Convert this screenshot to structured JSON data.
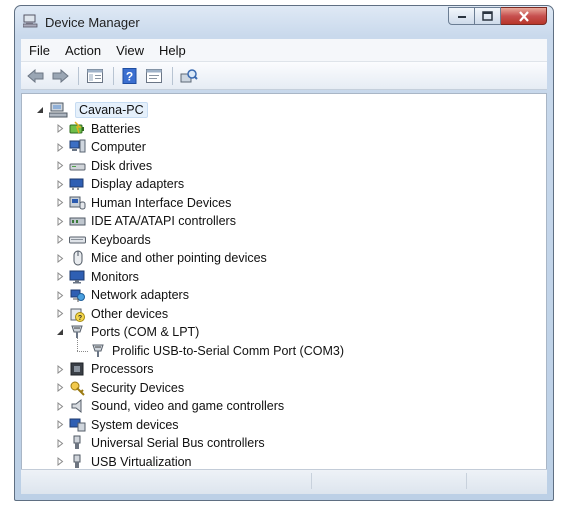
{
  "window": {
    "title": "Device Manager"
  },
  "menu": [
    "File",
    "Action",
    "View",
    "Help"
  ],
  "toolbar": {
    "buttons": [
      "back-arrow-icon",
      "forward-arrow-icon",
      "show-hide-console-tree-icon",
      "help-icon",
      "properties-icon",
      "scan-hardware-icon"
    ]
  },
  "tree": {
    "root": "Cavana-PC",
    "categories": [
      {
        "label": "Batteries",
        "icon": "battery-icon",
        "expanded": false
      },
      {
        "label": "Computer",
        "icon": "computer-icon",
        "expanded": false
      },
      {
        "label": "Disk drives",
        "icon": "disk-drive-icon",
        "expanded": false
      },
      {
        "label": "Display adapters",
        "icon": "display-adapter-icon",
        "expanded": false
      },
      {
        "label": "Human Interface Devices",
        "icon": "hid-icon",
        "expanded": false
      },
      {
        "label": "IDE ATA/ATAPI controllers",
        "icon": "ide-controller-icon",
        "expanded": false
      },
      {
        "label": "Keyboards",
        "icon": "keyboard-icon",
        "expanded": false
      },
      {
        "label": "Mice and other pointing devices",
        "icon": "mouse-icon",
        "expanded": false
      },
      {
        "label": "Monitors",
        "icon": "monitor-icon",
        "expanded": false
      },
      {
        "label": "Network adapters",
        "icon": "network-adapter-icon",
        "expanded": false
      },
      {
        "label": "Other devices",
        "icon": "other-devices-icon",
        "expanded": false
      },
      {
        "label": "Ports (COM & LPT)",
        "icon": "port-icon",
        "expanded": true,
        "children": [
          {
            "label": "Prolific USB-to-Serial Comm Port (COM3)",
            "icon": "port-icon"
          }
        ]
      },
      {
        "label": "Processors",
        "icon": "processor-icon",
        "expanded": false
      },
      {
        "label": "Security Devices",
        "icon": "security-device-icon",
        "expanded": false
      },
      {
        "label": "Sound, video and game controllers",
        "icon": "sound-icon",
        "expanded": false
      },
      {
        "label": "System devices",
        "icon": "system-devices-icon",
        "expanded": false
      },
      {
        "label": "Universal Serial Bus controllers",
        "icon": "usb-icon",
        "expanded": false
      },
      {
        "label": "USB Virtualization",
        "icon": "usb-icon",
        "expanded": false
      }
    ]
  }
}
